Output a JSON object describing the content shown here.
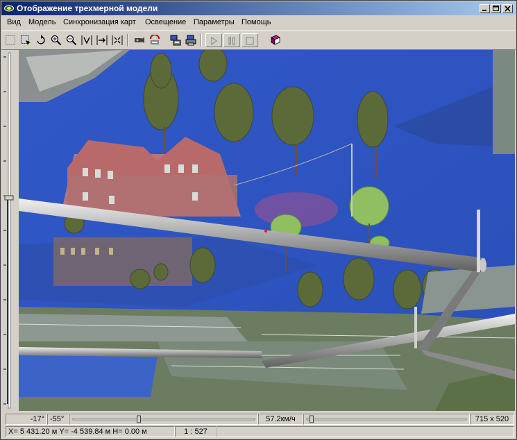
{
  "window": {
    "title": "Отображение трехмерной модели",
    "controls": {
      "minimize": "_",
      "maximize": "□",
      "close": "×"
    }
  },
  "menu": [
    "Вид",
    "Модель",
    "Синхронизация карт",
    "Освещение",
    "Параметры",
    "Помощь"
  ],
  "toolbar": {
    "icons": [
      "select-icon",
      "select-area-icon",
      "rotate-icon",
      "zoom-in-icon",
      "zoom-out-icon",
      "fit-view-icon",
      "pan-right-icon",
      "fit-all-icon",
      "camera-icon",
      "sync-map-icon",
      "export-icon",
      "print-icon",
      "play-icon",
      "pause-icon",
      "stop-icon",
      "help-book-icon"
    ]
  },
  "status": {
    "angle_horizontal": "-17°",
    "angle_vertical": "-55°",
    "speed": "57.2км/ч",
    "resolution": "715 x 520",
    "coords": "X= 5 431.20 м  Y= -4 539.84 м  H= 0.00 м",
    "scale": "1 : 527",
    "angle_slider_level": 0.36,
    "speed_slider_level": 0.02
  },
  "colors": {
    "titlebar_start": "#0a246a",
    "titlebar_end": "#a6caf0",
    "water": "#2f55c4",
    "window_bg": "#d4d0c8"
  }
}
